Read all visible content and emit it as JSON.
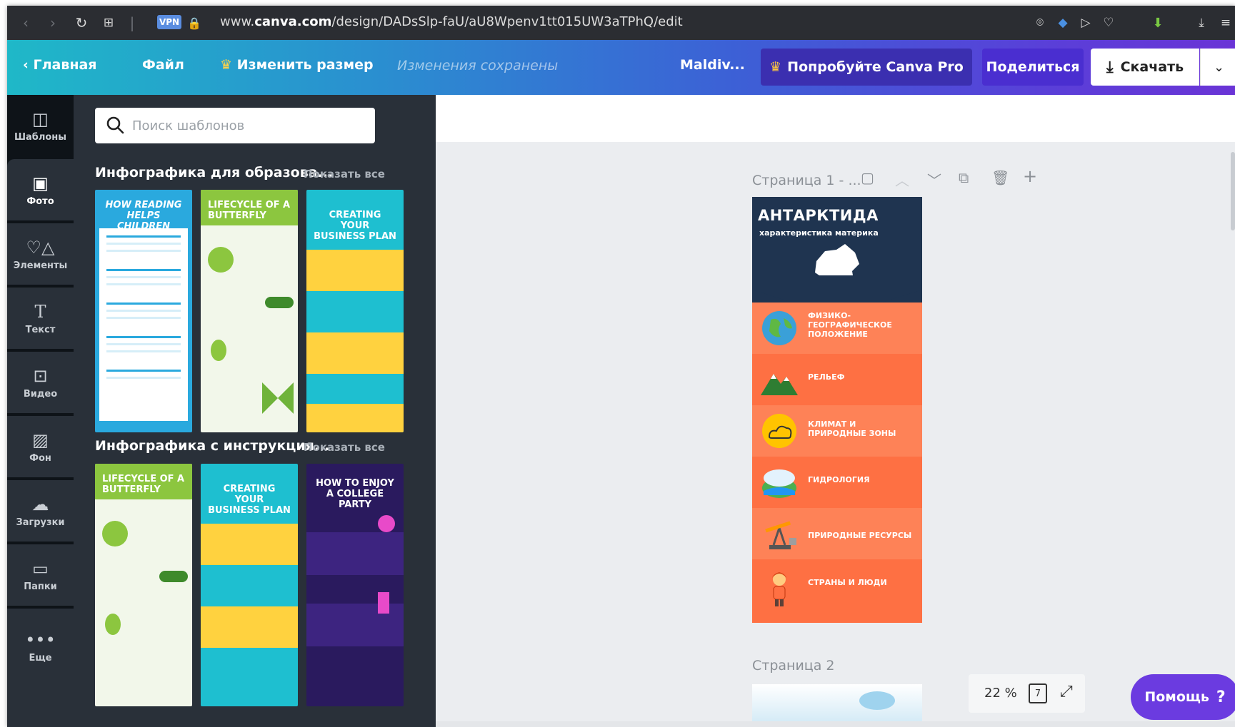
{
  "browser": {
    "url_prefix": "www.",
    "url_domain": "canva.com",
    "url_path": "/design/DADsSlp-faU/aU8Wpenv1tt015UW3aTPhQ/edit",
    "vpn_label": "VPN"
  },
  "topbar": {
    "home": "Главная",
    "file": "Файл",
    "resize": "Изменить размер",
    "saved_status": "Изменения сохранены",
    "design_title": "Maldiv...",
    "try_pro": "Попробуйте Canva Pro",
    "share": "Поделиться",
    "download": "Скачать"
  },
  "rail": {
    "items": [
      {
        "label": "Шаблоны",
        "icon": "templates-icon"
      },
      {
        "label": "Фото",
        "icon": "photo-icon"
      },
      {
        "label": "Элементы",
        "icon": "elements-icon"
      },
      {
        "label": "Текст",
        "icon": "text-icon"
      },
      {
        "label": "Видео",
        "icon": "video-icon"
      },
      {
        "label": "Фон",
        "icon": "background-icon"
      },
      {
        "label": "Загрузки",
        "icon": "uploads-icon"
      },
      {
        "label": "Папки",
        "icon": "folders-icon"
      },
      {
        "label": "Еще",
        "icon": "more-icon"
      }
    ]
  },
  "panel": {
    "search_placeholder": "Поиск шаблонов",
    "sections": [
      {
        "title": "Инфографика для образова...",
        "show_all": "Показать все",
        "templates": [
          {
            "title": "HOW READING HELPS CHILDREN",
            "bg": "#2aa9de"
          },
          {
            "title": "LIFECYCLE OF A BUTTERFLY",
            "bg": "#8cc63f"
          },
          {
            "title": "CREATING YOUR BUSINESS PLAN",
            "bg": "#1ebfd0"
          }
        ]
      },
      {
        "title": "Инфографика с инструкция...",
        "show_all": "Показать все",
        "templates": [
          {
            "title": "LIFECYCLE OF A BUTTERFLY",
            "bg": "#8cc63f"
          },
          {
            "title": "CREATING YOUR BUSINESS PLAN",
            "bg": "#1ebfd0"
          },
          {
            "title": "HOW TO ENJOY A COLLEGE PARTY",
            "bg": "#2a1a5e"
          }
        ]
      }
    ]
  },
  "canvas": {
    "page1_label": "Страница 1 - ...",
    "page2_label": "Страница 2",
    "zoom": "22 %",
    "page_count": "7",
    "help": "Помощь"
  },
  "page1": {
    "title": "АНТАРКТИДА",
    "subtitle": "характеристика материка",
    "rows": [
      {
        "label": "ФИЗИКО-ГЕОГРАФИЧЕСКОЕ ПОЛОЖЕНИЕ",
        "icon": "globe-icon"
      },
      {
        "label": "РЕЛЬЕФ",
        "icon": "mountains-icon"
      },
      {
        "label": "КЛИМАТ И ПРИРОДНЫЕ ЗОНЫ",
        "icon": "sun-cloud-icon"
      },
      {
        "label": "ГИДРОЛОГИЯ",
        "icon": "island-icon"
      },
      {
        "label": "ПРИРОДНЫЕ РЕСУРСЫ",
        "icon": "oil-pump-icon"
      },
      {
        "label": "СТРАНЫ И ЛЮДИ",
        "icon": "person-icon"
      }
    ]
  },
  "colors": {
    "page_orange": "#fe7043",
    "page_navy": "#1f3450",
    "panel_bg": "#293039",
    "rail_bg": "#0e1318",
    "help_purple": "#6b3be0"
  }
}
